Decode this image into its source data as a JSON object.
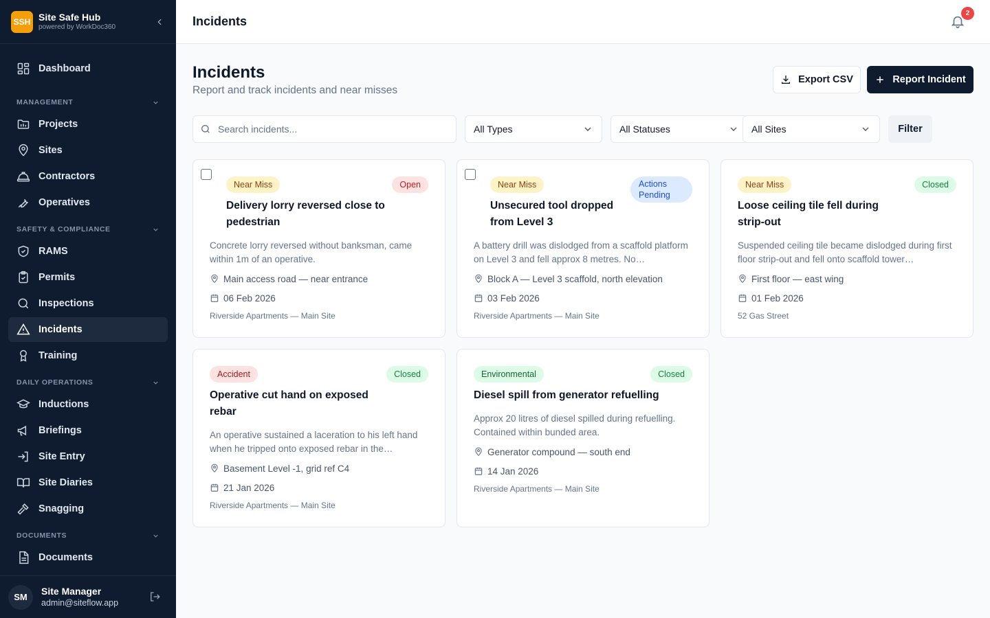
{
  "brand": {
    "logo": "SSH",
    "title": "Site Safe Hub",
    "subtitle": "powered by WorkDoc360"
  },
  "nav": {
    "dashboard": "Dashboard",
    "management_label": "MANAGEMENT",
    "management": [
      "Projects",
      "Sites",
      "Contractors",
      "Operatives"
    ],
    "safety_label": "SAFETY & COMPLIANCE",
    "safety": [
      "RAMS",
      "Permits",
      "Inspections",
      "Incidents",
      "Training"
    ],
    "daily_label": "DAILY OPERATIONS",
    "daily": [
      "Inductions",
      "Briefings",
      "Site Entry",
      "Site Diaries",
      "Snagging"
    ],
    "documents_label": "DOCUMENTS",
    "documents": [
      "Documents"
    ]
  },
  "user": {
    "initials": "SM",
    "name": "Site Manager",
    "email": "admin@siteflow.app"
  },
  "topbar": {
    "title": "Incidents",
    "notifications": "2"
  },
  "page": {
    "title": "Incidents",
    "subtitle": "Report and track incidents and near misses"
  },
  "actions": {
    "export": "Export CSV",
    "report": "Report Incident"
  },
  "filters": {
    "search_placeholder": "Search incidents...",
    "type": "All Types",
    "status": "All Statuses",
    "site": "All Sites",
    "filter_button": "Filter"
  },
  "incidents": [
    {
      "type": "Near Miss",
      "status": "Open",
      "title": "Delivery lorry reversed close to pedestrian",
      "description": "Concrete lorry reversed without banksman, came within 1m of an operative.",
      "location": "Main access road — near entrance",
      "date": "06 Feb 2026",
      "site": "Riverside Apartments — Main Site"
    },
    {
      "type": "Near Miss",
      "status": "Actions Pending",
      "title": "Unsecured tool dropped from Level 3",
      "description": "A battery drill was dislodged from a scaffold platform on Level 3 and fell approx 8 metres. No…",
      "location": "Block A — Level 3 scaffold, north elevation",
      "date": "03 Feb 2026",
      "site": "Riverside Apartments — Main Site"
    },
    {
      "type": "Near Miss",
      "status": "Closed",
      "title": "Loose ceiling tile fell during strip-out",
      "description": "Suspended ceiling tile became dislodged during first floor strip-out and fell onto scaffold tower…",
      "location": "First floor — east wing",
      "date": "01 Feb 2026",
      "site": "52 Gas Street"
    },
    {
      "type": "Accident",
      "status": "Closed",
      "title": "Operative cut hand on exposed rebar",
      "description": "An operative sustained a laceration to his left hand when he tripped onto exposed rebar in the…",
      "location": "Basement Level -1, grid ref C4",
      "date": "21 Jan 2026",
      "site": "Riverside Apartments — Main Site"
    },
    {
      "type": "Environmental",
      "status": "Closed",
      "title": "Diesel spill from generator refuelling",
      "description": "Approx 20 litres of diesel spilled during refuelling. Contained within bunded area.",
      "location": "Generator compound — south end",
      "date": "14 Jan 2026",
      "site": "Riverside Apartments — Main Site"
    }
  ]
}
